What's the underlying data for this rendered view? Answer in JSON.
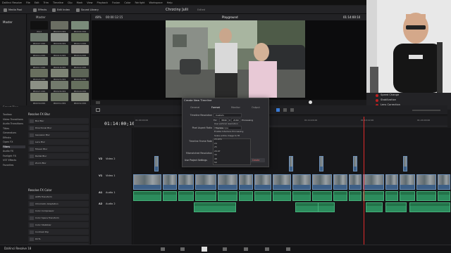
{
  "menu": [
    "DaVinci Resolve",
    "File",
    "Edit",
    "Trim",
    "Timeline",
    "Clip",
    "Mark",
    "View",
    "Playback",
    "Fusion",
    "Color",
    "Fairlight",
    "Workspace",
    "Help"
  ],
  "toolbar": {
    "media_pool": "Media Pool",
    "effects": "Effects",
    "edit_index": "Edit Index",
    "sound_library": "Sound Library",
    "project_title": "Chrzciny Julii",
    "project_status": "Edited"
  },
  "left": {
    "master": "Master",
    "smart_bins": "Smart Bins",
    "keywords": "Keywords"
  },
  "mediapool_header": {
    "label": "Master",
    "zoom": "2"
  },
  "thumbs": [
    "Wind",
    "PR0003.MP4",
    "PR0004.MP4",
    "PR0007.MP4",
    "PR0008.MP4",
    "PR0013.MP4",
    "PR0014.MP4",
    "PR0015.MP4",
    "PR0016.MP4",
    "PR0017.MP4",
    "PR0018.MP4",
    "PR0022.MP4",
    "PR0024.MP4",
    "PR0025.MP4",
    "PR0026.MP4",
    "PR0027.MP4",
    "PR0028.MP4",
    "PR0029.MP4",
    "PR0030.MP4",
    "PR0031.MP4",
    "PR0032.MP4"
  ],
  "effects": {
    "categories": [
      "Toolbox",
      "Video Transitions",
      "Audio Transitions",
      "Titles",
      "Generators",
      "Effects",
      "Open FX",
      "Filters",
      "Audio FX",
      "Fairlight FX",
      "VST Effects",
      "Favorites"
    ],
    "section1": "Resolve FX Blur",
    "items1": [
      "Box Blur",
      "Directional Blur",
      "Gaussian Blur",
      "Lens Blur",
      "Mosaic Blur",
      "Radial Blur",
      "Zoom Blur"
    ],
    "section2": "Resolve FX Color",
    "items2": [
      "ACES Transform",
      "Chromatic Adaptation",
      "Color Compressor",
      "Color Space Transform",
      "Color Stabilizer",
      "Contrast Pop",
      "DCTL",
      "Dehaze"
    ]
  },
  "viewer": {
    "zoom": "48%",
    "timecode_in": "00:00:12:15",
    "title": "Playground",
    "timecode": "01:14:00:10"
  },
  "timeline": {
    "timecode": "01:14:00;10",
    "ruler": [
      "01:00:00:00",
      "01:04:48:00",
      "01:09:36:00",
      "01:14:24:00",
      "01:19:12:00",
      "01:24:00:00"
    ],
    "tracks": [
      {
        "badge": "V2",
        "name": "Video 2"
      },
      {
        "badge": "V1",
        "name": "Video 1"
      },
      {
        "badge": "A1",
        "name": "Audio 1"
      },
      {
        "badge": "A2",
        "name": "Audio 2"
      }
    ]
  },
  "dialog": {
    "title": "Create New Timeline",
    "tabs": [
      "General",
      "Format",
      "Monitor",
      "Output"
    ],
    "timeline_resolution_label": "Timeline Resolution",
    "timeline_resolution_value": "Custom",
    "sizes": [
      "For",
      "3840",
      "x",
      "2160",
      "Processing"
    ],
    "pixel_aspect_label": "Pixel Aspect Ratio",
    "pixel_aspect_value": "Square",
    "framerate_label": "Timeline Frame Rate",
    "framerate_value": "24",
    "framerate_unit": "frames per second",
    "mismatched_label": "Mismatched Resolution",
    "mismatched_value": "Image to fit",
    "use_project_settings": "Use Project Settings",
    "cancel": "Cancel",
    "create": "Create",
    "options": [
      "Use vertical resolution",
      "Cinemascope",
      "Enable Interlace Processing",
      "Scale entire image to fit",
      "23.976",
      "24",
      "25",
      "29.97",
      "30",
      "48",
      "50"
    ]
  },
  "inspector": {
    "rows": [
      "Speed Change",
      "Stabilization",
      "Lens Correction"
    ]
  },
  "bottom": {
    "app": "DaVinci Resolve 18"
  }
}
